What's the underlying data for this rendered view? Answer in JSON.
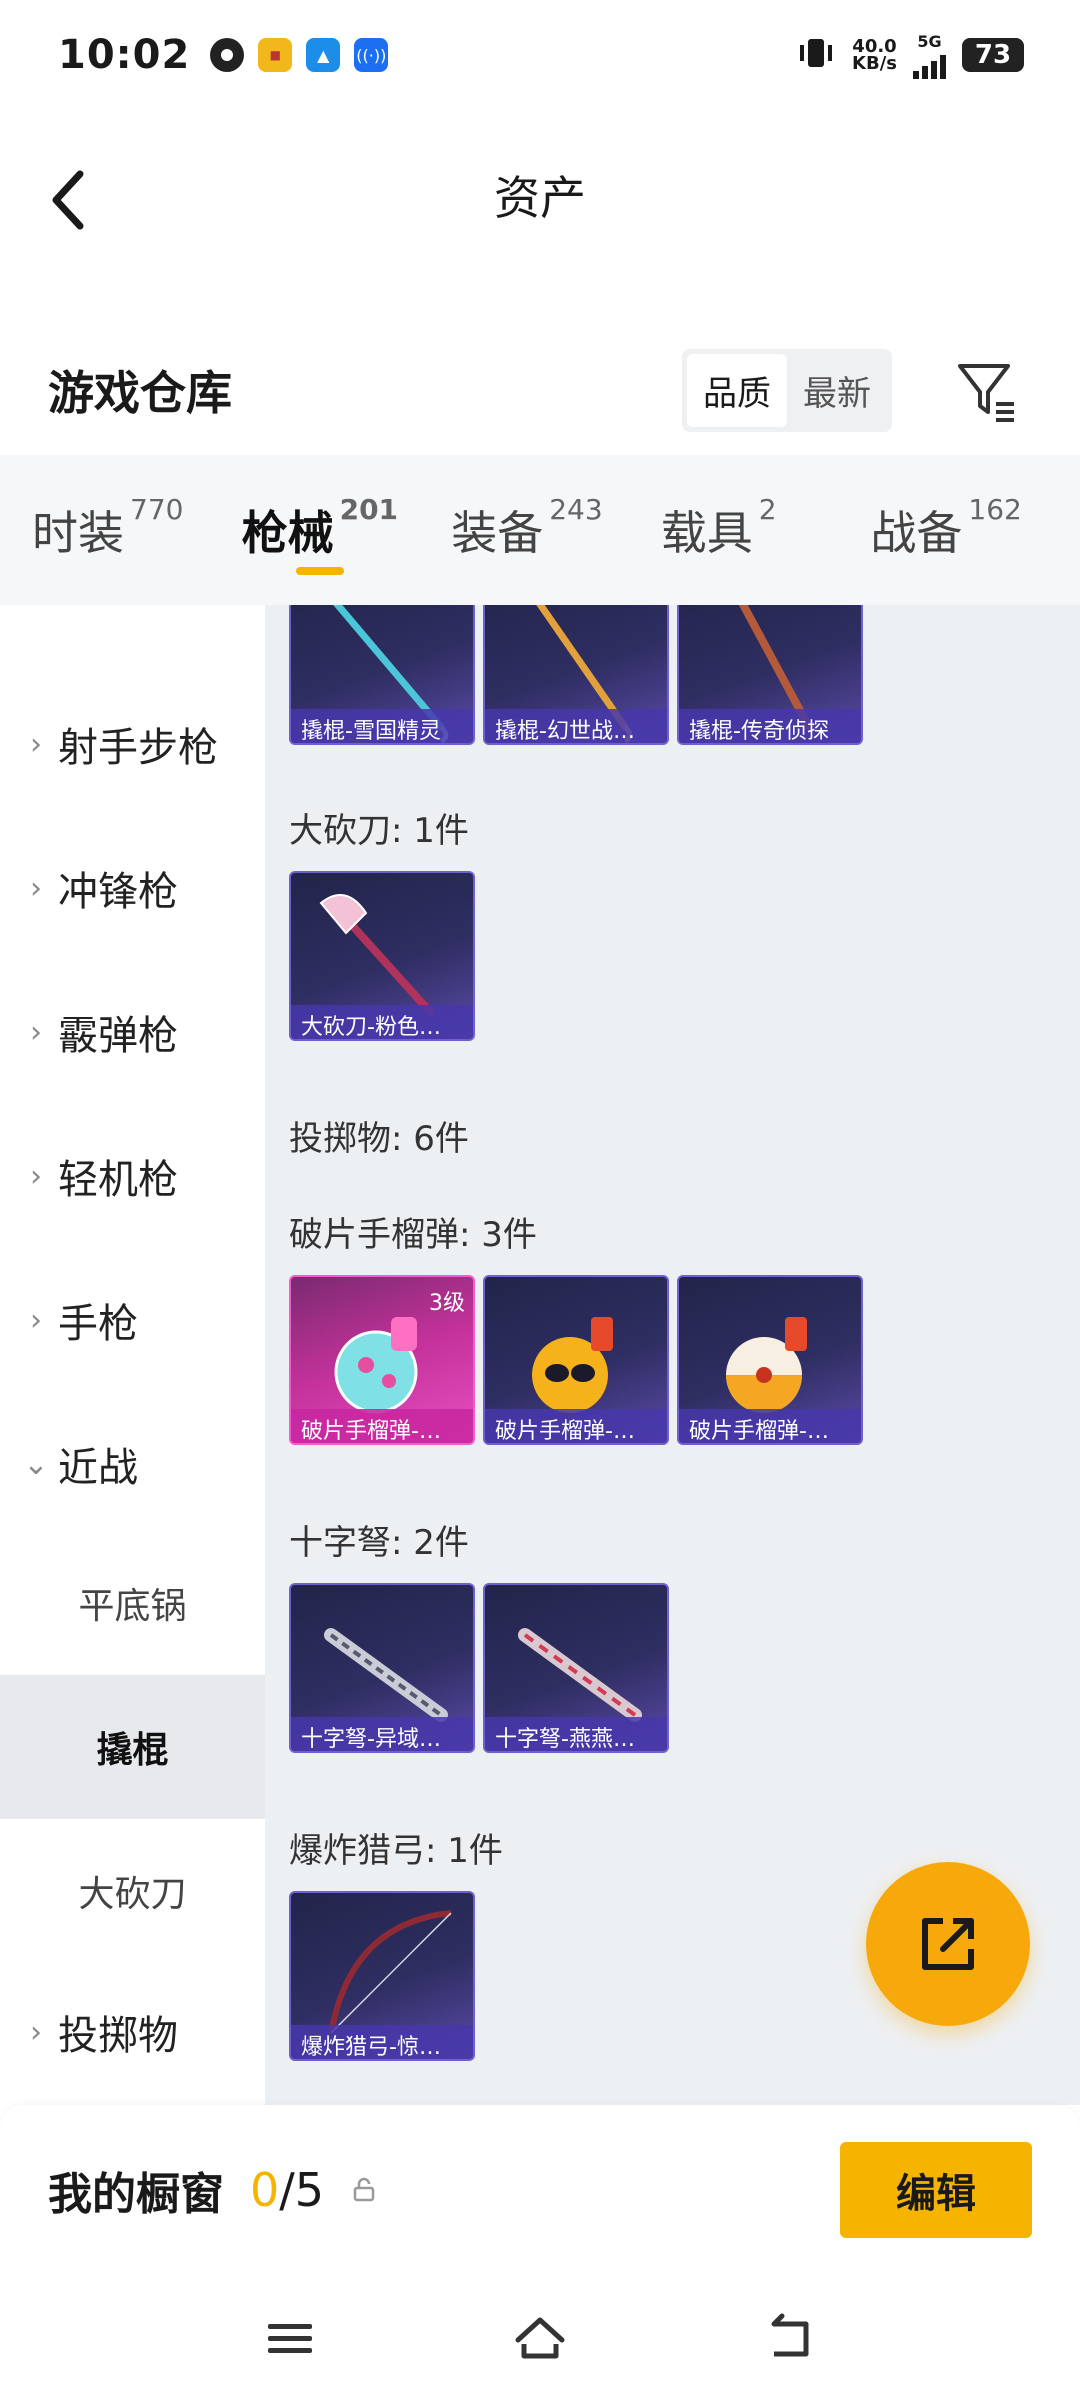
{
  "status_bar": {
    "time": "10:02",
    "net_speed": "40.0",
    "net_unit": "KB/s",
    "network": "5G",
    "battery": "73"
  },
  "header": {
    "title": "资产"
  },
  "warehouse": {
    "title": "游戏仓库",
    "sort_options": [
      "品质",
      "最新"
    ],
    "active_sort": "品质"
  },
  "tabs": [
    {
      "label": "时装",
      "count": "770"
    },
    {
      "label": "枪械",
      "count": "201"
    },
    {
      "label": "装备",
      "count": "243"
    },
    {
      "label": "载具",
      "count": "2"
    },
    {
      "label": "战备",
      "count": "162"
    }
  ],
  "active_tab": "枪械",
  "categories": [
    {
      "label": "射手步枪"
    },
    {
      "label": "冲锋枪"
    },
    {
      "label": "霰弹枪"
    },
    {
      "label": "轻机枪"
    },
    {
      "label": "手枪"
    },
    {
      "label": "近战"
    },
    {
      "label": "投掷物"
    }
  ],
  "subcategories": [
    {
      "label": "平底锅"
    },
    {
      "label": "撬棍"
    },
    {
      "label": "大砍刀"
    }
  ],
  "active_subcategory": "撬棍",
  "groups": [
    {
      "title": "",
      "items": [
        "撬棍-雪国精灵",
        "撬棍-幻世战…",
        "撬棍-传奇侦探"
      ]
    },
    {
      "title": "大砍刀: 1件",
      "items": [
        "大砍刀-粉色…"
      ]
    },
    {
      "title": "投掷物: 6件",
      "items": []
    },
    {
      "title": "破片手榴弹: 3件",
      "items": [
        "破片手榴弹-…",
        "破片手榴弹-…",
        "破片手榴弹-…"
      ],
      "first_level": "3级"
    },
    {
      "title": "十字弩: 2件",
      "items": [
        "十字弩-异域…",
        "十字弩-燕燕…"
      ]
    },
    {
      "title": "爆炸猎弓: 1件",
      "items": [
        "爆炸猎弓-惊…"
      ]
    }
  ],
  "showcase": {
    "title": "我的橱窗",
    "current": "0",
    "total": "/5",
    "edit_label": "编辑"
  },
  "colors": {
    "accent": "#f5b400",
    "card_purple": "#2f2e62",
    "card_pink": "#c5329b"
  }
}
